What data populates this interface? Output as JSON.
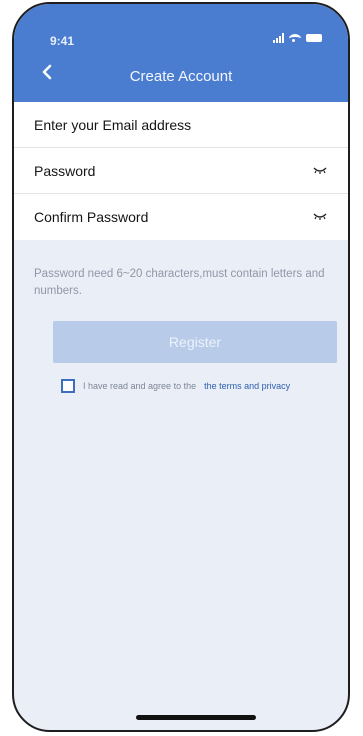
{
  "status_bar": {
    "time": "9:41"
  },
  "header": {
    "title": "Create Account",
    "back_icon": "chevron-left-icon"
  },
  "form": {
    "email_label": "Enter your Email address",
    "password_label": "Password",
    "confirm_password_label": "Confirm Password",
    "password_toggle_icon": "eye-closed-icon"
  },
  "hint_text": "Password need 6~20 characters,must contain letters and numbers.",
  "register_label": "Register",
  "agreement": {
    "text": "I have read and agree to the",
    "link_text": "the terms and privacy",
    "checked": false
  },
  "colors": {
    "header": "#4a7dcf",
    "background": "#e9eef7",
    "button_disabled": "#b8cbe9",
    "link": "#2e5fae"
  }
}
